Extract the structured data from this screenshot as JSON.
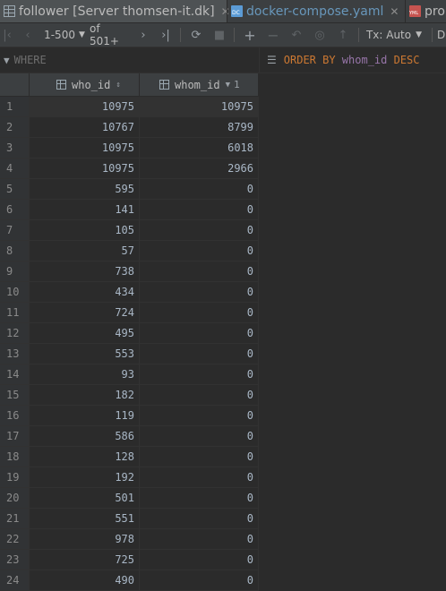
{
  "tabs": [
    {
      "label": "follower [Server thomsen-it.dk]",
      "icon": "table-icon",
      "active": true
    },
    {
      "label": "docker-compose.yaml",
      "icon": "docker-compose-file-icon",
      "active": false
    },
    {
      "label": "pro",
      "icon": "yaml-file-icon",
      "active": false
    }
  ],
  "toolbar": {
    "page_range": "1-500",
    "total": "of 501+",
    "tx_mode": "Tx: Auto",
    "trailing": "D"
  },
  "filter": {
    "where_placeholder": "WHERE",
    "order_kw": "ORDER BY",
    "order_col": "whom_id",
    "order_dir": "DESC"
  },
  "columns": {
    "who": "who_id",
    "whom": "whom_id",
    "whom_sort_index": "1"
  },
  "rows": [
    {
      "n": "1",
      "who": "10975",
      "whom": "10975"
    },
    {
      "n": "2",
      "who": "10767",
      "whom": "8799"
    },
    {
      "n": "3",
      "who": "10975",
      "whom": "6018"
    },
    {
      "n": "4",
      "who": "10975",
      "whom": "2966"
    },
    {
      "n": "5",
      "who": "595",
      "whom": "0"
    },
    {
      "n": "6",
      "who": "141",
      "whom": "0"
    },
    {
      "n": "7",
      "who": "105",
      "whom": "0"
    },
    {
      "n": "8",
      "who": "57",
      "whom": "0"
    },
    {
      "n": "9",
      "who": "738",
      "whom": "0"
    },
    {
      "n": "10",
      "who": "434",
      "whom": "0"
    },
    {
      "n": "11",
      "who": "724",
      "whom": "0"
    },
    {
      "n": "12",
      "who": "495",
      "whom": "0"
    },
    {
      "n": "13",
      "who": "553",
      "whom": "0"
    },
    {
      "n": "14",
      "who": "93",
      "whom": "0"
    },
    {
      "n": "15",
      "who": "182",
      "whom": "0"
    },
    {
      "n": "16",
      "who": "119",
      "whom": "0"
    },
    {
      "n": "17",
      "who": "586",
      "whom": "0"
    },
    {
      "n": "18",
      "who": "128",
      "whom": "0"
    },
    {
      "n": "19",
      "who": "192",
      "whom": "0"
    },
    {
      "n": "20",
      "who": "501",
      "whom": "0"
    },
    {
      "n": "21",
      "who": "551",
      "whom": "0"
    },
    {
      "n": "22",
      "who": "978",
      "whom": "0"
    },
    {
      "n": "23",
      "who": "725",
      "whom": "0"
    },
    {
      "n": "24",
      "who": "490",
      "whom": "0"
    }
  ]
}
